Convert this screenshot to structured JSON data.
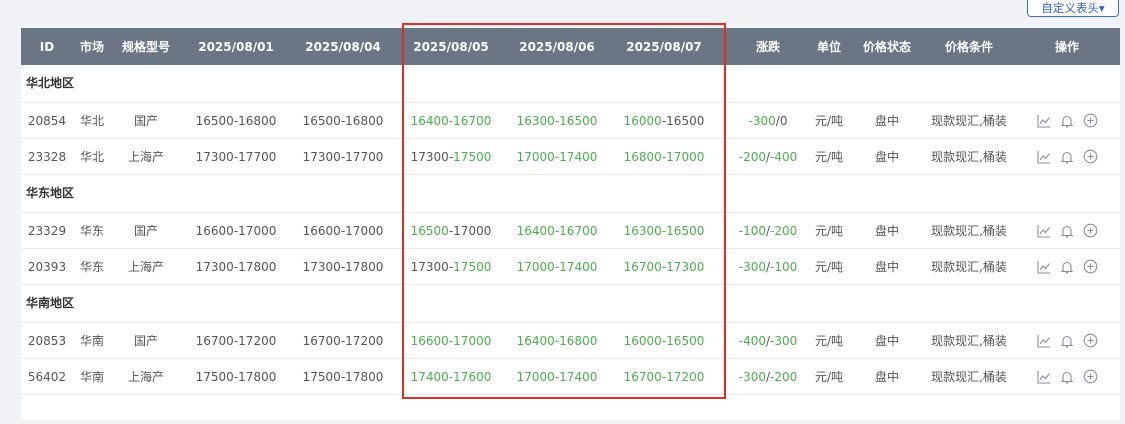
{
  "toolbar": {
    "custom_header_label": "自定义表头▾"
  },
  "columns": [
    "ID",
    "市场",
    "规格型号",
    "2025/08/01",
    "2025/08/04",
    "2025/08/05",
    "2025/08/06",
    "2025/08/07",
    "涨跌",
    "单位",
    "价格状态",
    "价格条件",
    "操作"
  ],
  "colors": {
    "header_bg": "#6a7683",
    "down_green": "#4cae4c",
    "highlight_red": "#d9312a",
    "link_blue": "#2f5fc4"
  },
  "groups": [
    {
      "title": "华北地区",
      "rows": [
        {
          "id": "20854",
          "market": "华北",
          "spec": "国产",
          "d1": [
            "16500",
            "-",
            "16800"
          ],
          "d2": [
            "16500",
            "-",
            "16800"
          ],
          "d3": [
            {
              "t": "16400",
              "g": true
            },
            {
              "t": "-",
              "g": true
            },
            {
              "t": "16700",
              "g": true
            }
          ],
          "d4": [
            {
              "t": "16300",
              "g": true
            },
            {
              "t": "-",
              "g": true
            },
            {
              "t": "16500",
              "g": true
            }
          ],
          "d5": [
            {
              "t": "16000",
              "g": true
            },
            {
              "t": "-",
              "g": false
            },
            {
              "t": "16500",
              "g": false
            }
          ],
          "chg": [
            {
              "t": "-300",
              "g": true
            },
            {
              "t": "/",
              "g": false
            },
            {
              "t": "0",
              "g": false
            }
          ],
          "unit": "元/吨",
          "status": "盘中",
          "cond": "现款现汇,桶装"
        },
        {
          "id": "23328",
          "market": "华北",
          "spec": "上海产",
          "d1": [
            "17300",
            "-",
            "17700"
          ],
          "d2": [
            "17300",
            "-",
            "17700"
          ],
          "d3": [
            {
              "t": "17300",
              "g": false
            },
            {
              "t": "-",
              "g": false
            },
            {
              "t": "17500",
              "g": true
            }
          ],
          "d4": [
            {
              "t": "17000",
              "g": true
            },
            {
              "t": "-",
              "g": true
            },
            {
              "t": "17400",
              "g": true
            }
          ],
          "d5": [
            {
              "t": "16800",
              "g": true
            },
            {
              "t": "-",
              "g": true
            },
            {
              "t": "17000",
              "g": true
            }
          ],
          "chg": [
            {
              "t": "-200",
              "g": true
            },
            {
              "t": "/",
              "g": false
            },
            {
              "t": "-400",
              "g": true
            }
          ],
          "unit": "元/吨",
          "status": "盘中",
          "cond": "现款现汇,桶装"
        }
      ]
    },
    {
      "title": "华东地区",
      "rows": [
        {
          "id": "23329",
          "market": "华东",
          "spec": "国产",
          "d1": [
            "16600",
            "-",
            "17000"
          ],
          "d2": [
            "16600",
            "-",
            "17000"
          ],
          "d3": [
            {
              "t": "16500",
              "g": true
            },
            {
              "t": "-",
              "g": false
            },
            {
              "t": "17000",
              "g": false
            }
          ],
          "d4": [
            {
              "t": "16400",
              "g": true
            },
            {
              "t": "-",
              "g": true
            },
            {
              "t": "16700",
              "g": true
            }
          ],
          "d5": [
            {
              "t": "16300",
              "g": true
            },
            {
              "t": "-",
              "g": true
            },
            {
              "t": "16500",
              "g": true
            }
          ],
          "chg": [
            {
              "t": "-100",
              "g": true
            },
            {
              "t": "/",
              "g": false
            },
            {
              "t": "-200",
              "g": true
            }
          ],
          "unit": "元/吨",
          "status": "盘中",
          "cond": "现款现汇,桶装"
        },
        {
          "id": "20393",
          "market": "华东",
          "spec": "上海产",
          "d1": [
            "17300",
            "-",
            "17800"
          ],
          "d2": [
            "17300",
            "-",
            "17800"
          ],
          "d3": [
            {
              "t": "17300",
              "g": false
            },
            {
              "t": "-",
              "g": false
            },
            {
              "t": "17500",
              "g": true
            }
          ],
          "d4": [
            {
              "t": "17000",
              "g": true
            },
            {
              "t": "-",
              "g": true
            },
            {
              "t": "17400",
              "g": true
            }
          ],
          "d5": [
            {
              "t": "16700",
              "g": true
            },
            {
              "t": "-",
              "g": true
            },
            {
              "t": "17300",
              "g": true
            }
          ],
          "chg": [
            {
              "t": "-300",
              "g": true
            },
            {
              "t": "/",
              "g": false
            },
            {
              "t": "-100",
              "g": true
            }
          ],
          "unit": "元/吨",
          "status": "盘中",
          "cond": "现款现汇,桶装"
        }
      ]
    },
    {
      "title": "华南地区",
      "rows": [
        {
          "id": "20853",
          "market": "华南",
          "spec": "国产",
          "d1": [
            "16700",
            "-",
            "17200"
          ],
          "d2": [
            "16700",
            "-",
            "17200"
          ],
          "d3": [
            {
              "t": "16600",
              "g": true
            },
            {
              "t": "-",
              "g": true
            },
            {
              "t": "17000",
              "g": true
            }
          ],
          "d4": [
            {
              "t": "16400",
              "g": true
            },
            {
              "t": "-",
              "g": true
            },
            {
              "t": "16800",
              "g": true
            }
          ],
          "d5": [
            {
              "t": "16000",
              "g": true
            },
            {
              "t": "-",
              "g": true
            },
            {
              "t": "16500",
              "g": true
            }
          ],
          "chg": [
            {
              "t": "-400",
              "g": true
            },
            {
              "t": "/",
              "g": false
            },
            {
              "t": "-300",
              "g": true
            }
          ],
          "unit": "元/吨",
          "status": "盘中",
          "cond": "现款现汇,桶装"
        },
        {
          "id": "56402",
          "market": "华南",
          "spec": "上海产",
          "d1": [
            "17500",
            "-",
            "17800"
          ],
          "d2": [
            "17500",
            "-",
            "17800"
          ],
          "d3": [
            {
              "t": "17400",
              "g": true
            },
            {
              "t": "-",
              "g": true
            },
            {
              "t": "17600",
              "g": true
            }
          ],
          "d4": [
            {
              "t": "17000",
              "g": true
            },
            {
              "t": "-",
              "g": true
            },
            {
              "t": "17400",
              "g": true
            }
          ],
          "d5": [
            {
              "t": "16700",
              "g": true
            },
            {
              "t": "-",
              "g": true
            },
            {
              "t": "17200",
              "g": true
            }
          ],
          "chg": [
            {
              "t": "-300",
              "g": true
            },
            {
              "t": "/",
              "g": false
            },
            {
              "t": "-200",
              "g": true
            }
          ],
          "unit": "元/吨",
          "status": "盘中",
          "cond": "现款现汇,桶装"
        }
      ]
    }
  ],
  "row_actions": [
    "trend-chart-icon",
    "bell-icon",
    "add-circle-icon"
  ]
}
